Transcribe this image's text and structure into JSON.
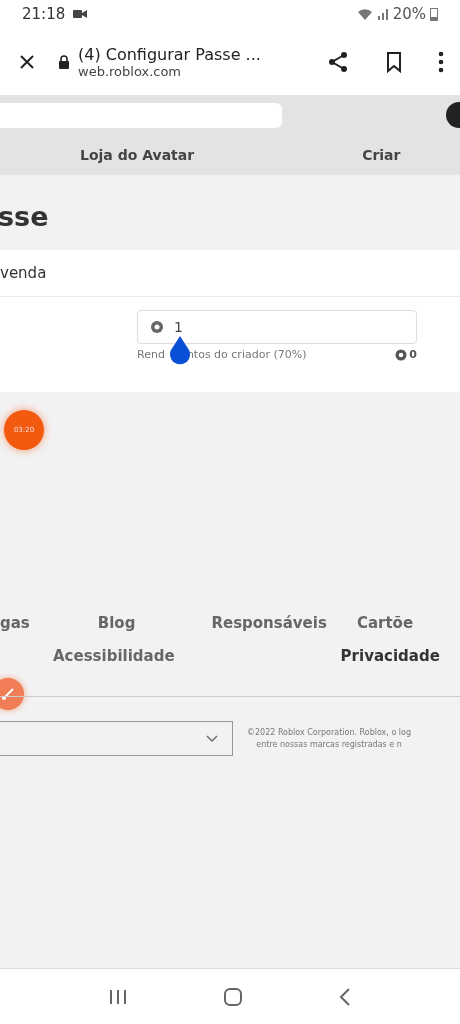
{
  "status_bar": {
    "time": "21:18",
    "battery": "20%"
  },
  "browser": {
    "title": "(4) Configurar Passe ...",
    "url": "web.roblox.com"
  },
  "site_nav": {
    "tabs": [
      {
        "label": "Loja do Avatar"
      },
      {
        "label": "Criar"
      }
    ]
  },
  "page": {
    "heading": "sse",
    "section_label": "venda",
    "price_field": {
      "value": "1"
    },
    "earnings_label": [
      "Rend",
      "ntos do criador (70%)"
    ],
    "earnings_value": "0"
  },
  "recorder": {
    "timer": "03:20"
  },
  "footer": {
    "links": [
      {
        "label": "gas",
        "emphasized": false
      },
      {
        "label": "Blog",
        "emphasized": false
      },
      {
        "label": "Responsáveis",
        "emphasized": false
      },
      {
        "label": "Cartõe",
        "emphasized": false
      }
    ],
    "links_row2": [
      {
        "label": "Acessibilidade",
        "emphasized": false
      },
      {
        "label": "Privacidade",
        "emphasized": true
      }
    ],
    "copyright": [
      "©2022 Roblox Corporation. Roblox, o log",
      "entre nossas marcas registradas e n"
    ]
  }
}
